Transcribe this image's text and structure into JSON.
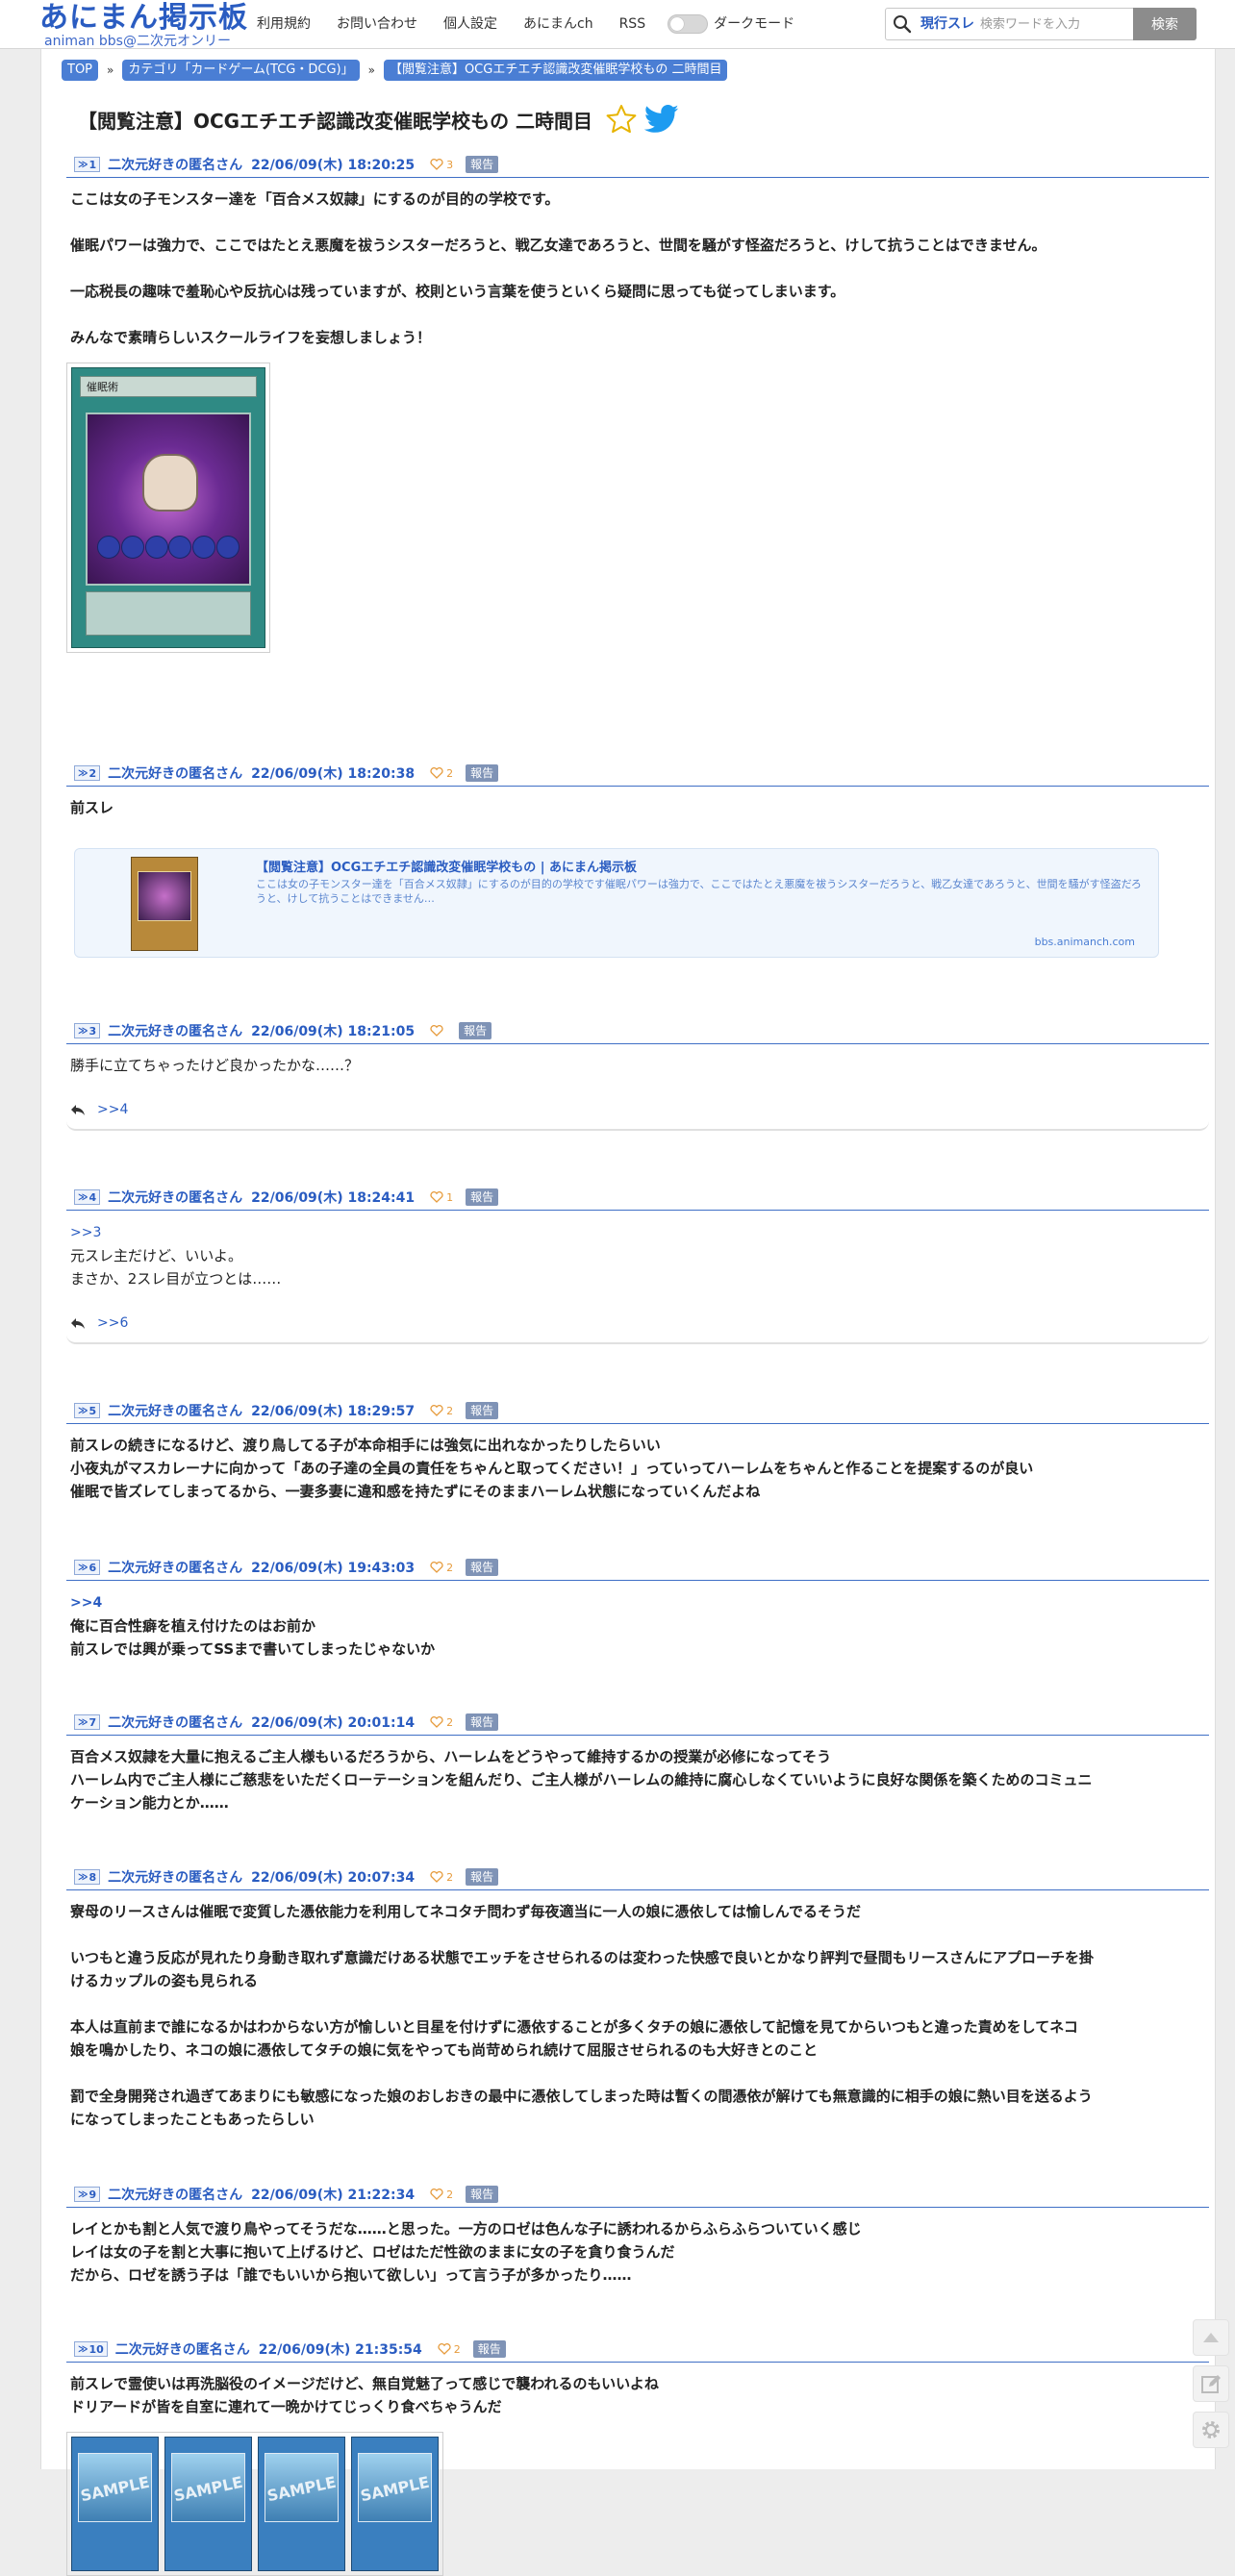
{
  "header": {
    "logo_main": "あにまん掲示板",
    "logo_sub": "animan bbs@二次元オンリー",
    "nav": [
      "利用規約",
      "お問い合わせ",
      "個人設定",
      "あにまんch",
      "RSS"
    ],
    "dark_mode_label": "ダークモード",
    "search_scope": "現行スレ",
    "search_placeholder": "検索ワードを入力",
    "search_button": "検索"
  },
  "breadcrumb": [
    "TOP",
    "カテゴリ「カードゲーム(TCG・DCG)」",
    "【閲覧注意】OCGエチエチ認識改変催眠学校もの 二時間目"
  ],
  "thread_title": "【閲覧注意】OCGエチエチ認識改変催眠学校もの 二時間目",
  "report_label": "報告",
  "posts": [
    {
      "no": "1",
      "name": "二次元好きの匿名さん",
      "date": "22/06/09(木) 18:20:25",
      "likes": "3",
      "body": [
        "ここは女の子モンスター達を「百合メス奴隷」にするのが目的の学校です。",
        "",
        "催眠パワーは強力で、ここではたとえ悪魔を祓うシスターだろうと、戦乙女達であろうと、世間を騒がす怪盗だろうと、けして抗うことはできません。",
        "",
        "一応税長の趣味で羞恥心や反抗心は残っていますが、校則という言葉を使うといくら疑問に思っても従ってしまいます。",
        "",
        "みんなで素晴らしいスクールライフを妄想しましょう！"
      ],
      "card_name": "催眠術"
    },
    {
      "no": "2",
      "name": "二次元好きの匿名さん",
      "date": "22/06/09(木) 18:20:38",
      "likes": "2",
      "body": [
        "前スレ"
      ],
      "link_card": {
        "title": "【閲覧注意】OCGエチエチ認識改変催眠学校もの | あにまん掲示板",
        "desc": "ここは女の子モンスター達を「百合メス奴隷」にするのが目的の学校です催眠パワーは強力で、ここではたとえ悪魔を祓うシスターだろうと、戦乙女達であろうと、世間を騒がす怪盗だろうと、けして抗うことはできません…",
        "domain": "bbs.animanch.com"
      }
    },
    {
      "no": "3",
      "name": "二次元好きの匿名さん",
      "date": "22/06/09(木) 18:21:05",
      "likes": "",
      "body": [
        "勝手に立てちゃったけど良かったかな……？"
      ],
      "reply": ">>4"
    },
    {
      "no": "4",
      "name": "二次元好きの匿名さん",
      "date": "22/06/09(木) 18:24:41",
      "likes": "1",
      "anchor": ">>3",
      "body": [
        "元スレ主だけど、いいよ。",
        "まさか、2スレ目が立つとは……"
      ],
      "reply": ">>6"
    },
    {
      "no": "5",
      "name": "二次元好きの匿名さん",
      "date": "22/06/09(木) 18:29:57",
      "likes": "2",
      "body": [
        "前スレの続きになるけど、渡り鳥してる子が本命相手には強気に出れなかったりしたらいい",
        "小夜丸がマスカレーナに向かって「あの子達の全員の責任をちゃんと取ってください！」っていってハーレムをちゃんと作ることを提案するのが良い",
        "催眠で皆ズレてしまってるから、一妻多妻に違和感を持たずにそのままハーレム状態になっていくんだよね"
      ]
    },
    {
      "no": "6",
      "name": "二次元好きの匿名さん",
      "date": "22/06/09(木) 19:43:03",
      "likes": "2",
      "anchor": ">>4",
      "body": [
        "俺に百合性癖を植え付けたのはお前か",
        "前スレでは興が乗ってSSまで書いてしまったじゃないか"
      ]
    },
    {
      "no": "7",
      "name": "二次元好きの匿名さん",
      "date": "22/06/09(木) 20:01:14",
      "likes": "2",
      "body": [
        "百合メス奴隷を大量に抱えるご主人様もいるだろうから、ハーレムをどうやって維持するかの授業が必修になってそう",
        "ハーレム内でご主人様にご慈悲をいただくローテーションを組んだり、ご主人様がハーレムの維持に腐心しなくていいように良好な関係を築くためのコミュニ",
        "ケーション能力とか……"
      ]
    },
    {
      "no": "8",
      "name": "二次元好きの匿名さん",
      "date": "22/06/09(木) 20:07:34",
      "likes": "2",
      "body": [
        "寮母のリースさんは催眠で変質した憑依能力を利用してネコタチ問わず毎夜適当に一人の娘に憑依しては愉しんでるそうだ",
        "",
        "いつもと違う反応が見れたり身動き取れず意識だけある状態でエッチをさせられるのは変わった快感で良いとかなり評判で昼間もリースさんにアプローチを掛",
        "けるカップルの姿も見られる",
        "",
        "本人は直前まで誰になるかはわからない方が愉しいと目星を付けずに憑依することが多くタチの娘に憑依して記憶を見てからいつもと違った責めをしてネコ",
        "娘を鳴かしたり、ネコの娘に憑依してタチの娘に気をやっても尚苛められ続けて屈服させられるのも大好きとのこと",
        "",
        "罰で全身開発され過ぎてあまりにも敏感になった娘のおしおきの最中に憑依してしまった時は暫くの間憑依が解けても無意識的に相手の娘に熱い目を送るよう",
        "になってしまったこともあったらしい"
      ]
    },
    {
      "no": "9",
      "name": "二次元好きの匿名さん",
      "date": "22/06/09(木) 21:22:34",
      "likes": "2",
      "body": [
        "レイとかも割と人気で渡り鳥やってそうだな……と思った。一方のロゼは色んな子に誘われるからふらふらついていく感じ",
        "レイは女の子を割と大事に抱いて上げるけど、ロゼはただ性欲のままに女の子を貪り食うんだ",
        "だから、ロゼを誘う子は「誰でもいいから抱いて欲しい」って言う子が多かったり……"
      ]
    },
    {
      "no": "10",
      "name": "二次元好きの匿名さん",
      "date": "22/06/09(木) 21:35:54",
      "likes": "2",
      "body": [
        "前スレで霊使いは再洗脳役のイメージだけど、無自覚魅了って感じで襲われるのもいいよね",
        "ドリアードが皆を自室に連れて一晩かけてじっくり食べちゃうんだ"
      ],
      "sample_label": "SAMPLE"
    }
  ],
  "colors": {
    "accent": "#2a5cc1",
    "breadcrumb": "#4a7ed4",
    "like": "#e69b3c",
    "report": "#7f93b6"
  }
}
